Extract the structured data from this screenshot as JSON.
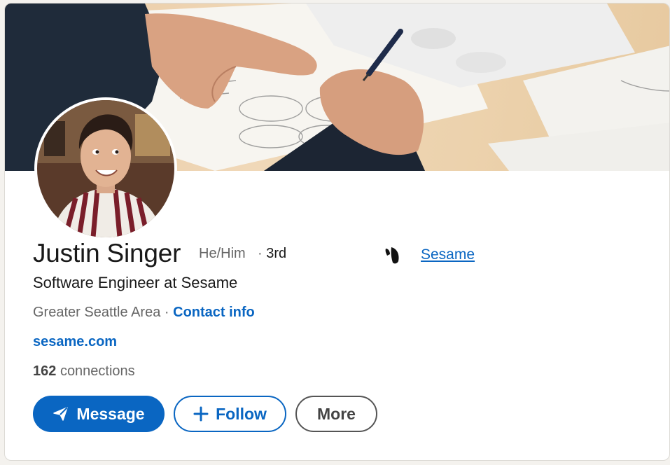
{
  "profile": {
    "name": "Justin Singer",
    "pronouns": "He/Him",
    "separator": "·",
    "degree": "3rd",
    "headline": "Software Engineer at Sesame",
    "location": "Greater Seattle Area",
    "contact_label": "Contact info",
    "website": "sesame.com",
    "connections_count": "162",
    "connections_label": "connections"
  },
  "company": {
    "name": "Sesame",
    "logo_icon": "sesame-logo-icon"
  },
  "actions": {
    "message_label": "Message",
    "message_icon": "send-icon",
    "follow_label": "Follow",
    "follow_icon": "plus-icon",
    "more_label": "More"
  },
  "colors": {
    "accent": "#0a66c2",
    "text": "#191919",
    "muted": "#666666"
  }
}
